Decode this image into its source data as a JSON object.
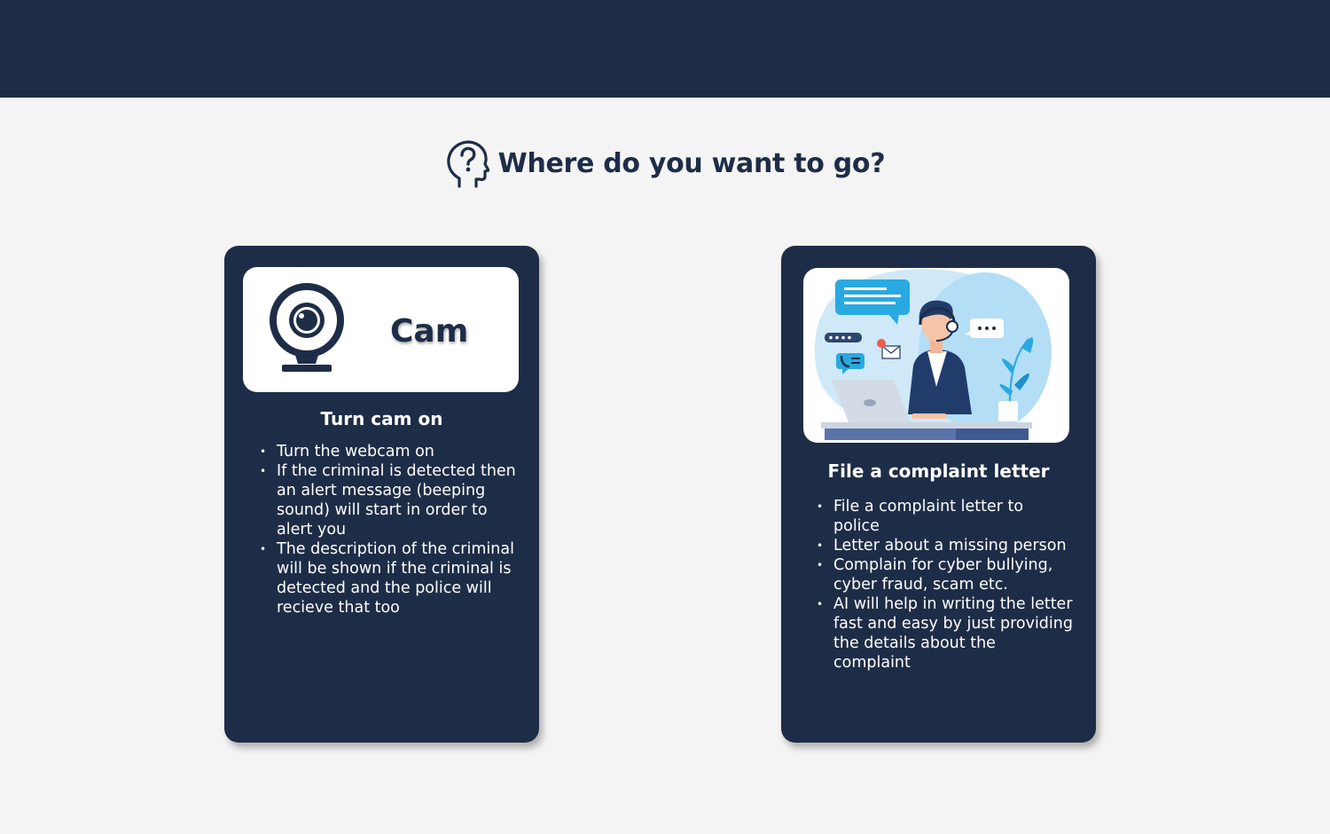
{
  "heading": {
    "title": "Where do you want to go?",
    "icon": "head-question-icon"
  },
  "cards": {
    "cam": {
      "panel_label": "Cam",
      "icon": "webcam-icon",
      "title": "Turn cam on",
      "items": [
        "Turn the webcam on",
        "If the criminal is detected then an alert message (beeping sound) will start in order to alert you",
        "The description of the criminal will be shown if the criminal is detected and the police will recieve that too"
      ]
    },
    "letter": {
      "illustration": "support-agent-illustration",
      "title": "File a complaint letter",
      "items": [
        "File a complaint letter to police",
        "Letter about a missing person",
        "Complain for cyber bullying, cyber fraud, scam etc.",
        "AI will help in writing the letter fast and easy by just providing the details about the complaint"
      ]
    }
  },
  "colors": {
    "navy": "#1e2d47",
    "background": "#f4f4f4",
    "panel": "#ffffff",
    "accent_blue": "#29a9e1"
  }
}
